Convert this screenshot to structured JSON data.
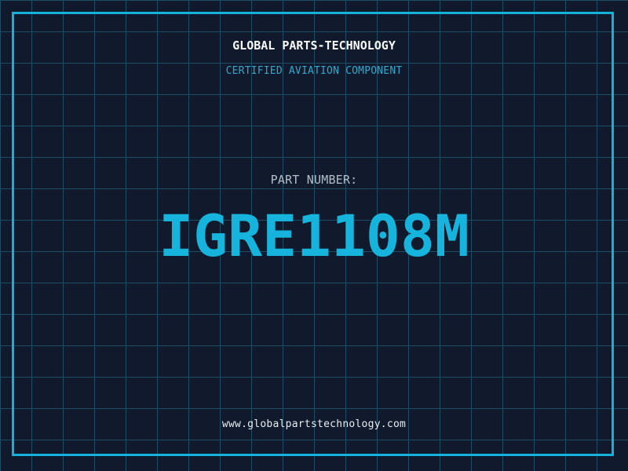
{
  "header": {
    "company_name": "GLOBAL PARTS-TECHNOLOGY",
    "certification": "CERTIFIED AVIATION COMPONENT"
  },
  "part": {
    "label": "PART NUMBER:",
    "number": "IGRE1108M"
  },
  "footer": {
    "website": "www.globalpartstechnology.com"
  },
  "colors": {
    "background": "#101a2c",
    "grid_line": "#1e4c63",
    "frame_border": "#14b2da",
    "part_number_cyan": "#16b4dc",
    "certification_cyan": "#2fa8cc",
    "label_gray": "#b3bfc8",
    "company_white": "#fafafa",
    "website_white": "#e8eef0"
  }
}
